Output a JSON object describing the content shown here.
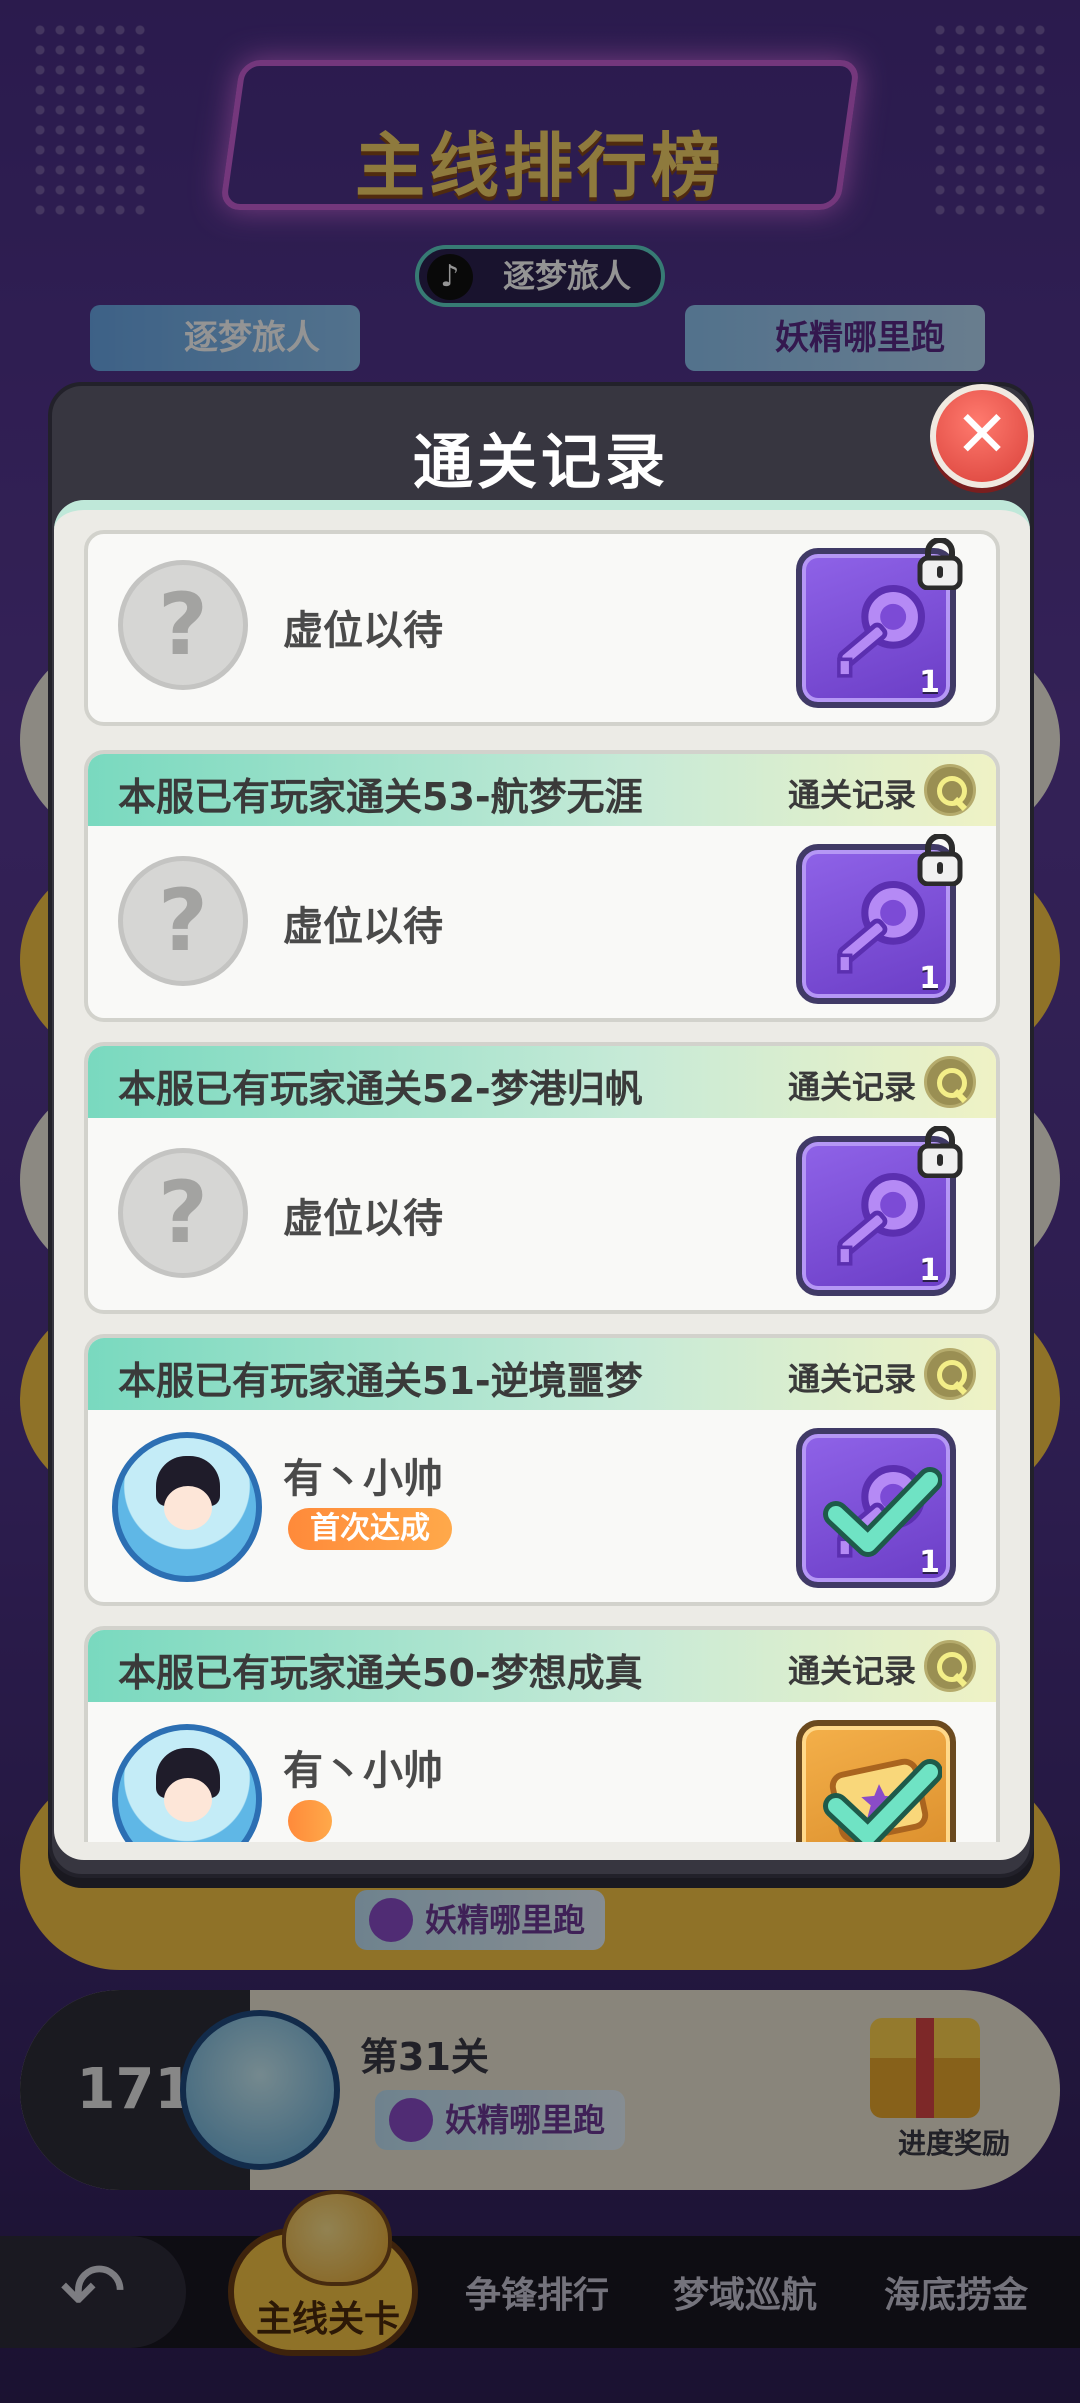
{
  "background": {
    "title": "主线排行榜",
    "platform_pill": "逐梦旅人",
    "banner_left": "逐梦旅人",
    "banner_right": "妖精哪里跑",
    "row_partial_tag": "妖精哪里跑",
    "row_visible": {
      "rank": "171",
      "level": "第31关",
      "tag": "妖精哪里跑",
      "reward_label": "进度奖励"
    }
  },
  "nav": {
    "back_icon": "back-arrow-icon",
    "items": [
      {
        "label": "主线关卡",
        "active": true
      },
      {
        "label": "争锋排行",
        "active": false
      },
      {
        "label": "梦域巡航",
        "active": false
      },
      {
        "label": "海底捞金",
        "active": false
      }
    ]
  },
  "modal": {
    "title": "通关记录",
    "close_icon": "close-icon",
    "cards": [
      {
        "header": "",
        "link": "",
        "player": "虚位以待",
        "achieved": false,
        "reward_count": "1",
        "reward_type": "purple-key",
        "locked": true
      },
      {
        "header": "本服已有玩家通关53-航梦无涯",
        "link": "通关记录",
        "player": "虚位以待",
        "achieved": false,
        "reward_count": "1",
        "reward_type": "purple-key",
        "locked": true
      },
      {
        "header": "本服已有玩家通关52-梦港归帆",
        "link": "通关记录",
        "player": "虚位以待",
        "achieved": false,
        "reward_count": "1",
        "reward_type": "purple-key",
        "locked": true
      },
      {
        "header": "本服已有玩家通关51-逆境噩梦",
        "link": "通关记录",
        "player": "有丶小帅",
        "badge": "首次达成",
        "achieved": true,
        "reward_count": "1",
        "reward_type": "purple-key",
        "locked": false
      },
      {
        "header": "本服已有玩家通关50-梦想成真",
        "link": "通关记录",
        "player": "有丶小帅",
        "achieved": true,
        "reward_type": "gold-ticket",
        "locked": false
      }
    ]
  },
  "colors": {
    "accent_green": "#79d9bf",
    "badge_orange": "#ff8a3a",
    "close_red": "#d9413a",
    "reward_purple": "#6b3dc6"
  }
}
